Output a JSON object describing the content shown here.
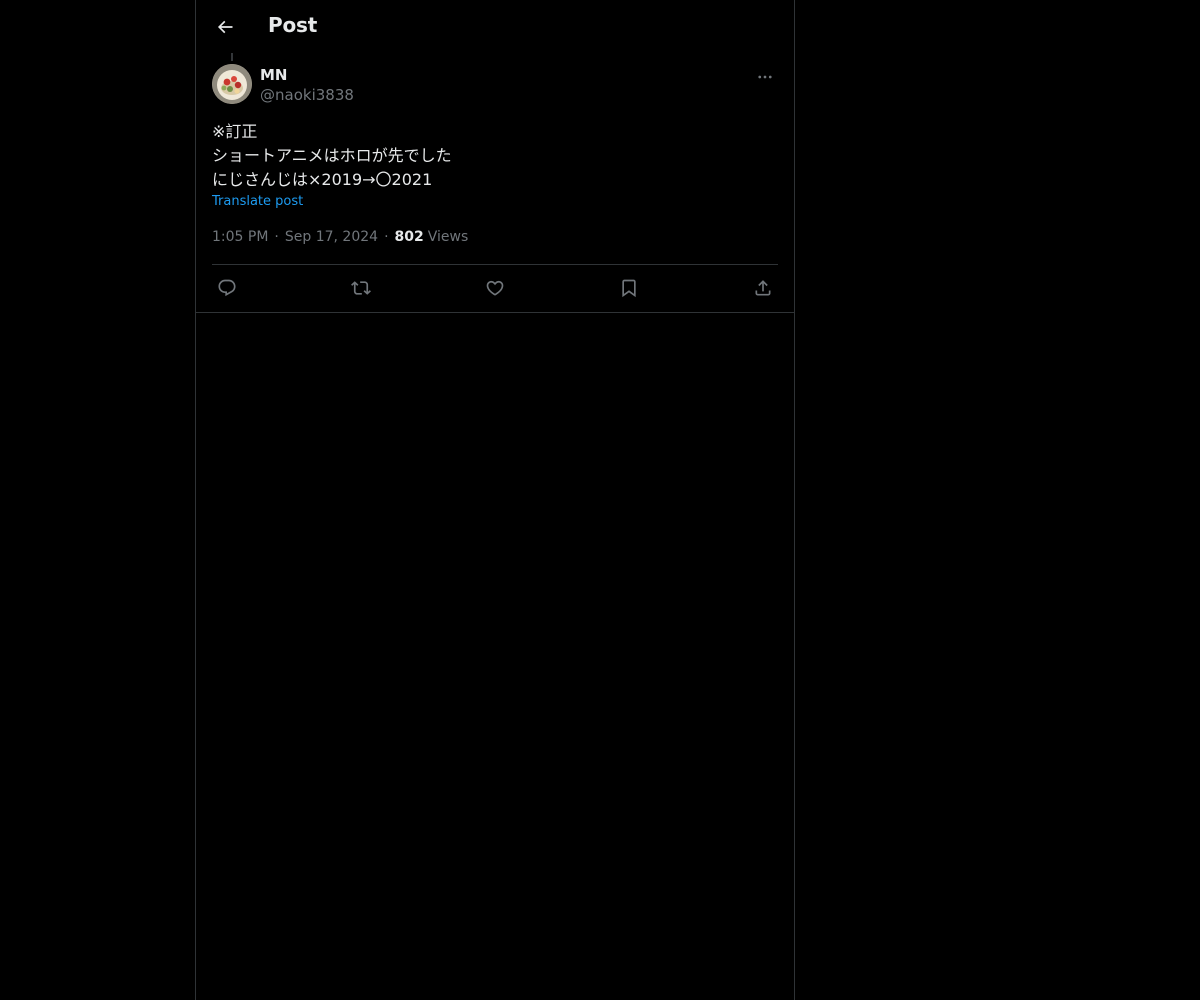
{
  "header": {
    "title": "Post",
    "back_icon": "arrow-left-icon"
  },
  "post": {
    "author": {
      "display_name": "MN",
      "handle": "@naoki3838"
    },
    "text_lines": [
      "※訂正",
      "ショートアニメはホロが先でした",
      "にじさんじは×2019→〇2021"
    ],
    "translate_label": "Translate post",
    "time": "1:05 PM",
    "date": "Sep 17, 2024",
    "views_count": "802",
    "views_label": "Views",
    "separator": "·"
  },
  "actions": [
    {
      "name": "reply",
      "icon": "reply-icon"
    },
    {
      "name": "repost",
      "icon": "repost-icon"
    },
    {
      "name": "like",
      "icon": "heart-icon"
    },
    {
      "name": "bookmark",
      "icon": "bookmark-icon"
    },
    {
      "name": "share",
      "icon": "share-icon"
    }
  ],
  "colors": {
    "background": "#000000",
    "text": "#e7e9ea",
    "muted": "#71767b",
    "link": "#1d9bf0",
    "border": "#2f3336"
  }
}
